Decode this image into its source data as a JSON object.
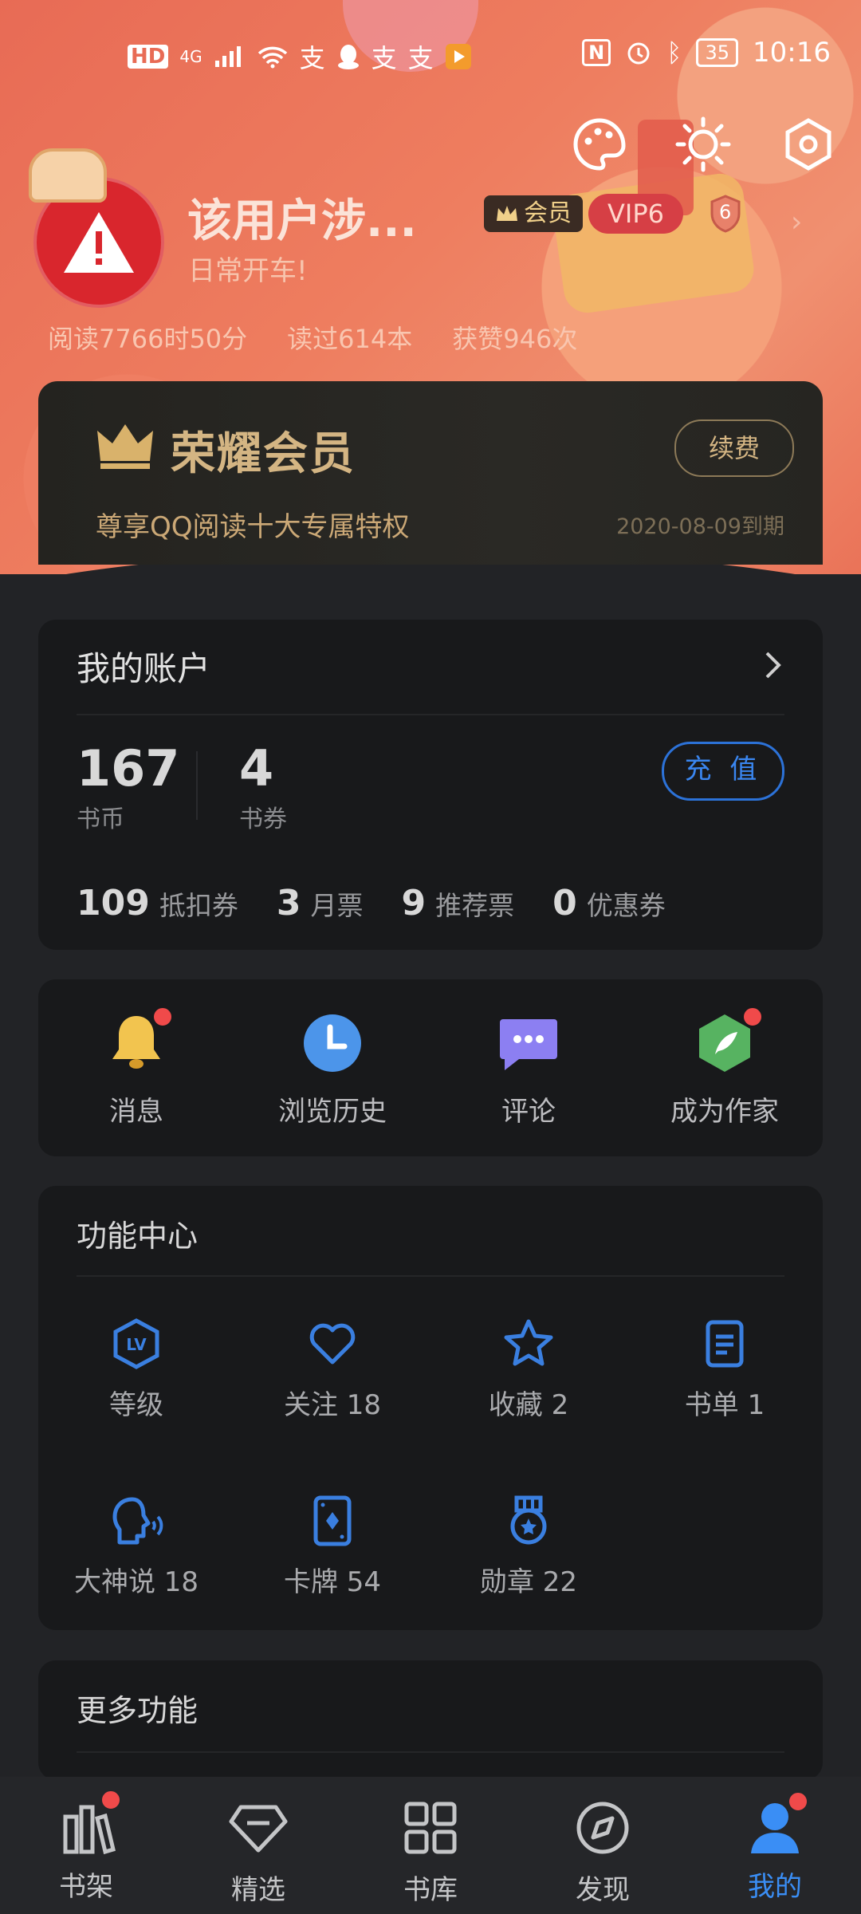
{
  "status_bar": {
    "left_icons": [
      "HD",
      "4G",
      "signal-icon",
      "wifi-icon",
      "alipay-icon",
      "qq-icon",
      "alipay-icon",
      "alipay-icon",
      "video-icon"
    ],
    "battery": "35",
    "time": "10:16"
  },
  "profile": {
    "username": "该用户涉...",
    "tagline": "日常开车!",
    "member_badge": "会员",
    "vip_badge": "VIP6",
    "level_badge": "6",
    "stats": [
      "阅读7766时50分",
      "读过614本",
      "获赞946次"
    ]
  },
  "vip_card": {
    "title": "荣耀会员",
    "renew_label": "续费",
    "description": "尊享QQ阅读十大专属特权",
    "expiry": "2020-08-09到期"
  },
  "account": {
    "title": "我的账户",
    "coins": {
      "value": "167",
      "label": "书币"
    },
    "vouchers": {
      "value": "4",
      "label": "书券"
    },
    "recharge_label": "充 值",
    "tickets": [
      {
        "value": "109",
        "label": "抵扣券"
      },
      {
        "value": "3",
        "label": "月票"
      },
      {
        "value": "9",
        "label": "推荐票"
      },
      {
        "value": "0",
        "label": "优惠券"
      }
    ]
  },
  "quick_actions": [
    {
      "label": "消息",
      "icon": "bell-icon"
    },
    {
      "label": "浏览历史",
      "icon": "clock-icon"
    },
    {
      "label": "评论",
      "icon": "comment-icon"
    },
    {
      "label": "成为作家",
      "icon": "quill-icon"
    }
  ],
  "function_center": {
    "title": "功能中心",
    "items": [
      {
        "label": "等级",
        "icon": "level-icon"
      },
      {
        "label": "关注 18",
        "icon": "heart-icon"
      },
      {
        "label": "收藏 2",
        "icon": "star-icon"
      },
      {
        "label": "书单 1",
        "icon": "booklist-icon"
      },
      {
        "label": "大神说 18",
        "icon": "speaking-head-icon"
      },
      {
        "label": "卡牌 54",
        "icon": "card-icon"
      },
      {
        "label": "勋章 22",
        "icon": "medal-icon"
      }
    ]
  },
  "more": {
    "title": "更多功能"
  },
  "tabbar": [
    {
      "label": "书架",
      "icon": "bookshelf-icon"
    },
    {
      "label": "精选",
      "icon": "diamond-icon"
    },
    {
      "label": "书库",
      "icon": "grid-icon"
    },
    {
      "label": "发现",
      "icon": "compass-icon"
    },
    {
      "label": "我的",
      "icon": "person-icon"
    }
  ],
  "colors": {
    "accent": "#3a8ef5",
    "gold": "#d4b583",
    "header": "#ea7358",
    "background": "#222326",
    "card": "#18191b"
  }
}
